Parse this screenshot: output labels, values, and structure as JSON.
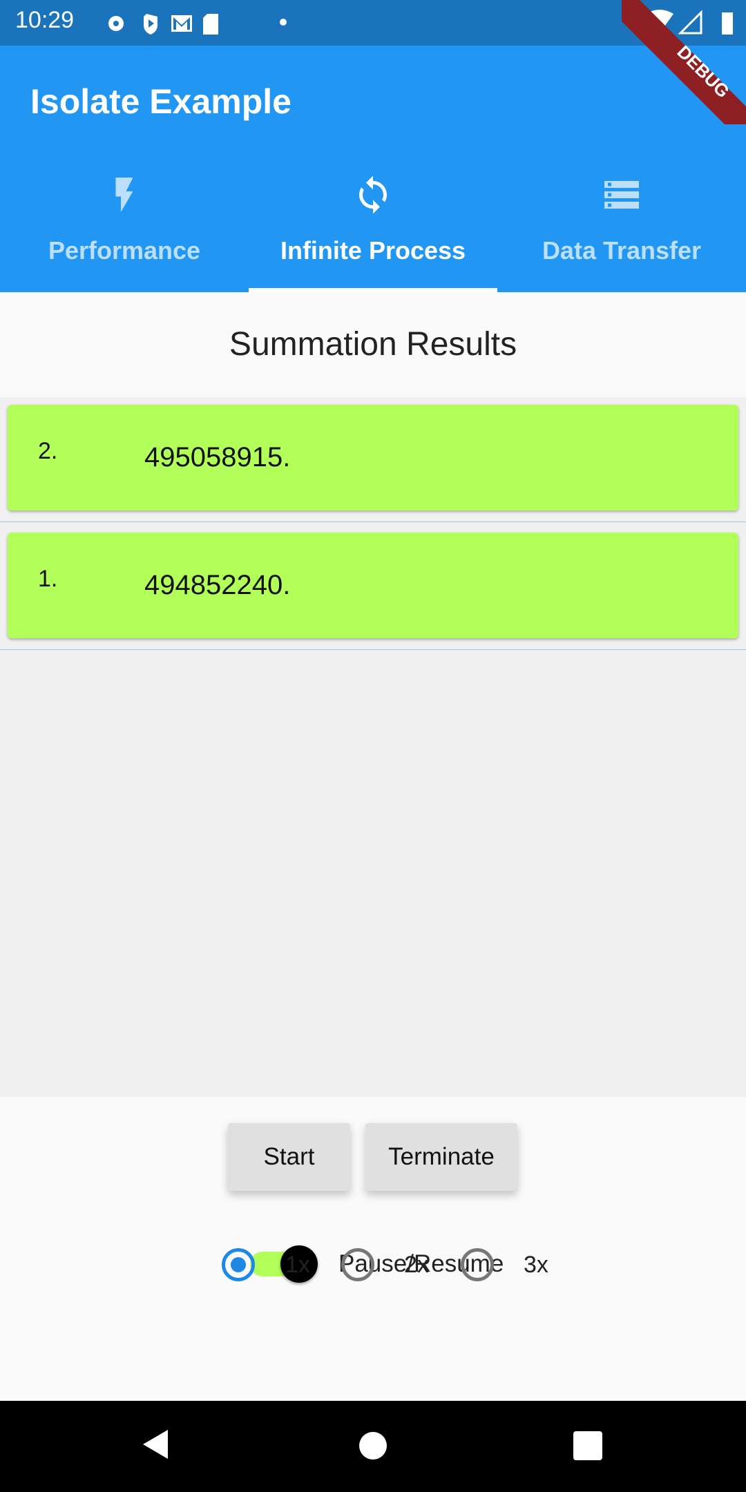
{
  "status_bar": {
    "time": "10:29",
    "icons": [
      "settings-icon",
      "play-protect-icon",
      "gmail-icon",
      "sd-card-icon",
      "dot-icon",
      "wifi-icon",
      "signal-icon",
      "battery-icon"
    ]
  },
  "debug_banner": "DEBUG",
  "app_bar": {
    "title": "Isolate Example"
  },
  "tabs": [
    {
      "label": "Performance",
      "icon": "flash-icon"
    },
    {
      "label": "Infinite Process",
      "icon": "sync-icon",
      "active": true
    },
    {
      "label": "Data Transfer",
      "icon": "storage-icon"
    }
  ],
  "main": {
    "header": "Summation Results",
    "results": [
      {
        "index": "2.",
        "value": "495058915."
      },
      {
        "index": "1.",
        "value": "494852240."
      }
    ]
  },
  "controls": {
    "start_label": "Start",
    "terminate_label": "Terminate",
    "switch_label": "Pause/Resume",
    "switch_on": true,
    "speed_options": [
      "1x",
      "2x",
      "3x"
    ],
    "speed_selected": "1x"
  },
  "colors": {
    "primary": "#2196f3",
    "status_bar": "#1b74bb",
    "card": "#b2ff59",
    "radio_selected": "#1e88e5"
  }
}
